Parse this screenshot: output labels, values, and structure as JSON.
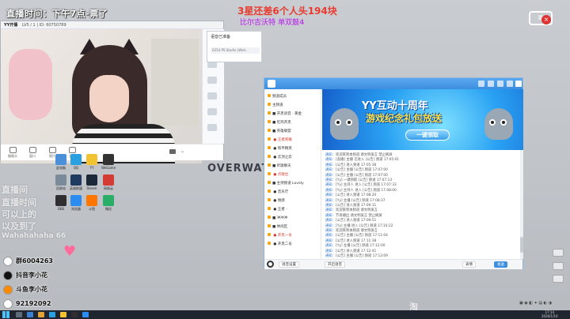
{
  "overlay": {
    "time_note": "直播时间：下午7点-票了",
    "title": "3星还差6个人头194块",
    "subtitle": "比尔吉沃特  单双鼓4",
    "overwatch_text": "OVERWATC",
    "taobao_text": "淘",
    "ghost_lines": [
      "直播间 ",
      "直播时间",
      "可以上的",
      "以及到了",
      "Wahahahaha 66"
    ]
  },
  "social": {
    "items": [
      {
        "icon": "qq-group-icon",
        "text": "群6004263"
      },
      {
        "icon": "douyin-icon",
        "text": "抖音李小花"
      },
      {
        "icon": "weibo-icon",
        "text": "斗鱼李小花"
      },
      {
        "icon": "qq-icon",
        "text": "92192092"
      }
    ]
  },
  "cam_window": {
    "app_name": "YY开播",
    "title_info": "LV5 / 1  |  ID: 60750789",
    "popup_title": "语音已准备",
    "popup_item": "0254 PS Studio (Wed...",
    "toolbar": [
      {
        "icon": "camera-icon",
        "label": "摄像头"
      },
      {
        "icon": "share-screen-icon",
        "label": "窗口"
      },
      {
        "icon": "picture-icon",
        "label": "图片"
      },
      {
        "icon": "text-icon",
        "label": "文字"
      }
    ],
    "side_items": [
      "pause-icon",
      "record-icon",
      "settings-icon",
      "gift-icon",
      "music-icon",
      "more-icon"
    ]
  },
  "desktop_icons": [
    {
      "label": "此电脑",
      "color": "#4a90d9"
    },
    {
      "label": "QQ",
      "color": "#29a0e0"
    },
    {
      "label": "YY",
      "color": "#f1c232"
    },
    {
      "label": "WeGame",
      "color": "#333333"
    },
    {
      "label": "回收站",
      "color": "#7a8a99"
    },
    {
      "label": "英雄联盟",
      "color": "#1e3a5f"
    },
    {
      "label": "Steam",
      "color": "#1b2838"
    },
    {
      "label": "网易云",
      "color": "#d43c33"
    },
    {
      "label": "OBS",
      "color": "#302e31"
    },
    {
      "label": "浏览器",
      "color": "#2d8cf0"
    },
    {
      "label": "斗鱼",
      "color": "#ff7700"
    },
    {
      "label": "微信",
      "color": "#2aae67"
    }
  ],
  "yy": {
    "top_title": "",
    "left_rows": [
      {
        "text": "频道成员",
        "red": false
      },
      {
        "text": "主频道",
        "red": false
      },
      {
        "text": "■ 开黑语音 · 黄金",
        "red": false
      },
      {
        "text": "■ 吃鸡开黑",
        "red": false
      },
      {
        "text": "■ 英雄联盟",
        "red": false
      },
      {
        "text": "  ● 王者荣耀",
        "red": true
      },
      {
        "text": "  ● 和平精英",
        "red": false
      },
      {
        "text": "  ● 云顶之弈",
        "red": false
      },
      {
        "text": "■ 听歌聊天",
        "red": false
      },
      {
        "text": "  ● 点歌台",
        "red": true
      },
      {
        "text": "■ 主持频道 Lovely",
        "red": false
      },
      {
        "text": "  ● 音乐厅",
        "red": false
      },
      {
        "text": "  ● 情感",
        "red": false
      },
      {
        "text": "  ● 王者 ·",
        "red": false
      },
      {
        "text": "■ 冲冲冲",
        "red": false
      },
      {
        "text": "■ 休闲区",
        "red": false
      },
      {
        "text": "  ● 开黑一号",
        "red": true
      },
      {
        "text": "  ● 开黑二号",
        "red": false
      }
    ],
    "banner": {
      "title": "YY互动十周年",
      "subtitle": "游戏纪念礼包放送",
      "button": "一键领取"
    },
    "log_lines": [
      {
        "who": "通知:",
        "msg": "欢迎来到本频道 请文明发言 禁止刷屏"
      },
      {
        "who": "通知:",
        "msg": "[直播] 主播 已进入 [公告] 频道 17:05:01"
      },
      {
        "who": "通知:",
        "msg": "[公告] 进入频道 17:05:38"
      },
      {
        "who": "通知:",
        "msg": "[公告] 主播 [公告] 频道 17:07:00"
      },
      {
        "who": "通知:",
        "msg": "[公告] 主播 [公告] 频道 17:07:00"
      },
      {
        "who": "通知:",
        "msg": "[Yy] 一键领取 [公告] 频道 17:07:13"
      },
      {
        "who": "通知:",
        "msg": "[Yy] 主持人 进入 [公告] 频道 17:07:33"
      },
      {
        "who": "通知:",
        "msg": "[Yy] 主持人 进入 [公告] 频道 17:08:00"
      },
      {
        "who": "通知:",
        "msg": "[公告] 进入频道 17:08:20"
      },
      {
        "who": "通知:",
        "msg": "[Yy] 主播 [公告] 频道 17:08:37"
      },
      {
        "who": "通知:",
        "msg": "[公告] 进入频道 17:09:11"
      },
      {
        "who": "通知:",
        "msg": "欢迎来到本频道 请文明发言"
      },
      {
        "who": "通知:",
        "msg": "节目播出 请文明发言 禁止刷屏"
      },
      {
        "who": "通知:",
        "msg": "[公告] 进入频道 17:09:51"
      },
      {
        "who": "通知:",
        "msg": "[Yy] 主播 进入 [公告] 频道 17:10:22"
      },
      {
        "who": "通知:",
        "msg": "欢迎来到本频道 请文明发言"
      },
      {
        "who": "通知:",
        "msg": "[公告] 主播 [公告] 频道 17:11:04"
      },
      {
        "who": "通知:",
        "msg": "[公告] 进入频道 17:11:38"
      },
      {
        "who": "通知:",
        "msg": "[Yy] 主播 [公告] 频道 17:12:00"
      },
      {
        "who": "通知:",
        "msg": "[公告] 进入频道 17:12:41"
      },
      {
        "who": "通知:",
        "msg": "[公告] 主播 [公告] 频道 17:13:09"
      }
    ],
    "bottom_buttons": [
      "语音设置",
      "开启语音",
      "表情",
      "发送"
    ]
  },
  "taskbar": {
    "clock_time": "17:14",
    "clock_date": "2020/1/10"
  }
}
